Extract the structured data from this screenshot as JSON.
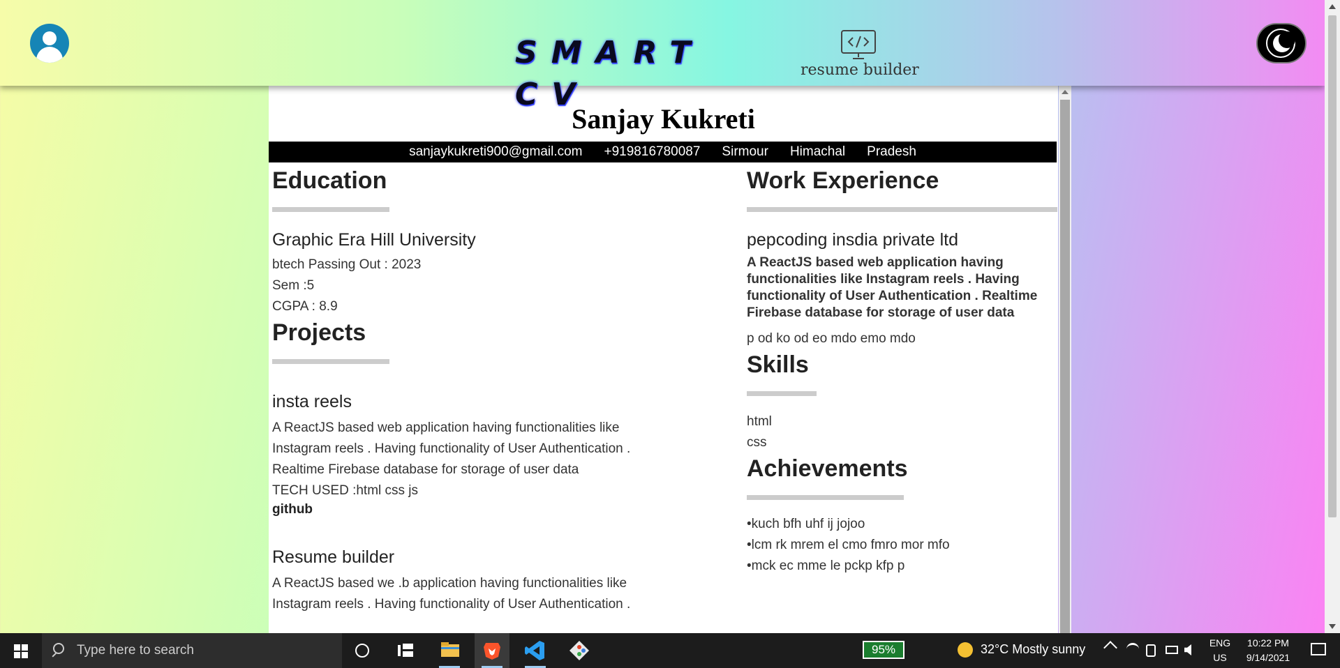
{
  "header": {
    "brand_title": "SMART CV",
    "brand_subtitle": "resume builder",
    "code_icon": "code-monitor-icon",
    "avatar_icon": "user-avatar-icon",
    "theme_icon": "moon-icon"
  },
  "resume": {
    "name": "Sanjay Kukreti",
    "contact": [
      "sanjaykukreti900@gmail.com",
      "+919816780087",
      "Sirmour",
      "Himachal",
      "Pradesh"
    ],
    "education": {
      "title": "Education",
      "institution": "Graphic Era Hill University",
      "lines": [
        "btech Passing Out : 2023",
        "Sem :5",
        "CGPA : 8.9"
      ]
    },
    "projects": {
      "title": "Projects",
      "items": [
        {
          "name": "insta reels",
          "description": "A ReactJS based web application having functionalities like Instagram reels . Having functionality of User Authentication . Realtime Firebase database for storage of user data",
          "tech": "TECH USED :html css js",
          "link": "github"
        },
        {
          "name": "Resume builder",
          "description": "A ReactJS based we .b application having functionalities like Instagram reels . Having functionality of User Authentication ."
        }
      ]
    },
    "work": {
      "title": "Work Experience",
      "company": "pepcoding insdia private ltd",
      "description": "A ReactJS based web application having functionalities like Instagram reels . Having functionality of User Authentication . Realtime Firebase database for storage of user data",
      "note": "p od ko od eo mdo emo mdo"
    },
    "skills": {
      "title": "Skills",
      "items": [
        "html",
        "css"
      ]
    },
    "achievements": {
      "title": "Achievements",
      "items": [
        "•kuch bfh uhf ij jojoo",
        "•lcm rk mrem el cmo fmro mor mfo",
        "•mck ec mme le pckp kfp p"
      ]
    }
  },
  "taskbar": {
    "search_placeholder": "Type here to search",
    "battery_app_label": "95%",
    "weather": "32°C  Mostly sunny",
    "lang_1": "ENG",
    "lang_2": "US",
    "time": "10:22 PM",
    "date": "9/14/2021",
    "apps": [
      "file-explorer-icon",
      "brave-browser-icon",
      "vscode-icon",
      "git-icon"
    ]
  },
  "colors": {
    "accent_blue": "#1685b6",
    "contact_bar": "#000000",
    "rule": "#cccccc"
  }
}
